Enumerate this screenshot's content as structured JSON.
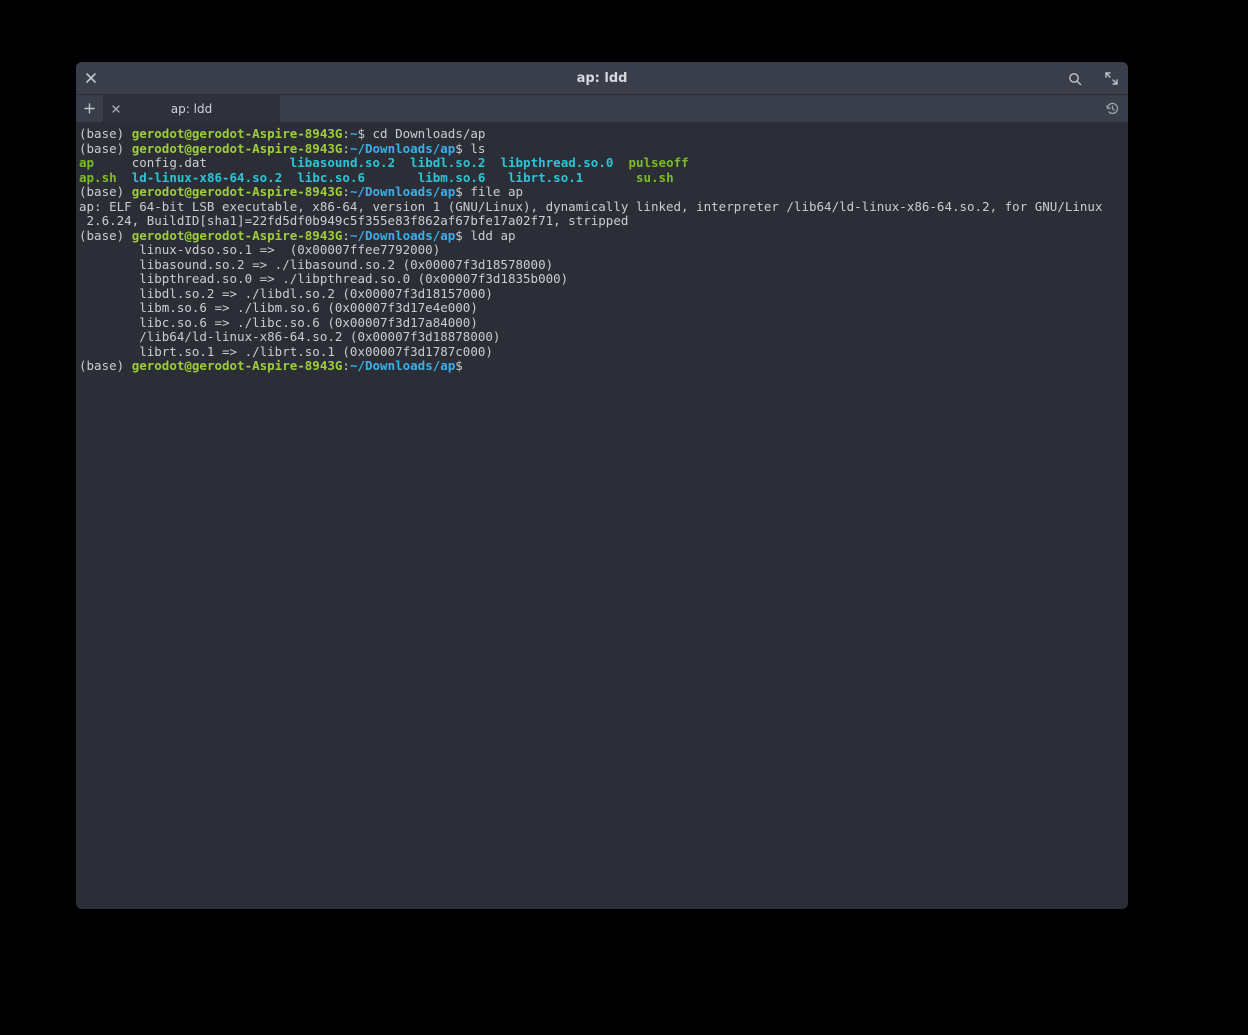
{
  "window": {
    "title": "ap: ldd"
  },
  "tab": {
    "label": "ap: ldd"
  },
  "prompt_base": "(base) ",
  "prompt_user": "gerodot@gerodot-Aspire-8943G",
  "prompt_home_colon": ":",
  "prompt_home_tilde": "~",
  "prompt_home_path": "~/Downloads/ap",
  "prompt_dollar": "$ ",
  "lines": {
    "cd_cmd": "cd Downloads/ap",
    "ls_cmd": "ls",
    "ls_row1_col1": "ap",
    "ls_row1_col2": "     config.dat           ",
    "ls_row1_col3": "libasound.so.2",
    "ls_row1_col4": "  ",
    "ls_row1_col5": "libdl.so.2",
    "ls_row1_col6": "  ",
    "ls_row1_col7": "libpthread.so.0",
    "ls_row1_col8": "  ",
    "ls_row1_col9": "pulseoff",
    "ls_row2_col1": "ap.sh",
    "ls_row2_col2": "  ",
    "ls_row2_col3": "ld-linux-x86-64.so.2",
    "ls_row2_col4": "  ",
    "ls_row2_col5": "libc.so.6",
    "ls_row2_col6": "       ",
    "ls_row2_col7": "libm.so.6",
    "ls_row2_col8": "   ",
    "ls_row2_col9": "librt.so.1",
    "ls_row2_col10": "       ",
    "ls_row2_col11": "su.sh",
    "file_cmd": "file ap",
    "file_out1": "ap: ELF 64-bit LSB executable, x86-64, version 1 (GNU/Linux), dynamically linked, interpreter /lib64/ld-linux-x86-64.so.2, for GNU/Linux",
    "file_out2": " 2.6.24, BuildID[sha1]=22fd5df0b949c5f355e83f862af67bfe17a02f71, stripped",
    "ldd_cmd": "ldd ap",
    "ldd_out1": "        linux-vdso.so.1 =>  (0x00007ffee7792000)",
    "ldd_out2": "        libasound.so.2 => ./libasound.so.2 (0x00007f3d18578000)",
    "ldd_out3": "        libpthread.so.0 => ./libpthread.so.0 (0x00007f3d1835b000)",
    "ldd_out4": "        libdl.so.2 => ./libdl.so.2 (0x00007f3d18157000)",
    "ldd_out5": "        libm.so.6 => ./libm.so.6 (0x00007f3d17e4e000)",
    "ldd_out6": "        libc.so.6 => ./libc.so.6 (0x00007f3d17a84000)",
    "ldd_out7": "        /lib64/ld-linux-x86-64.so.2 (0x00007f3d18878000)",
    "ldd_out8": "        librt.so.1 => ./librt.so.1 (0x00007f3d1787c000)"
  }
}
